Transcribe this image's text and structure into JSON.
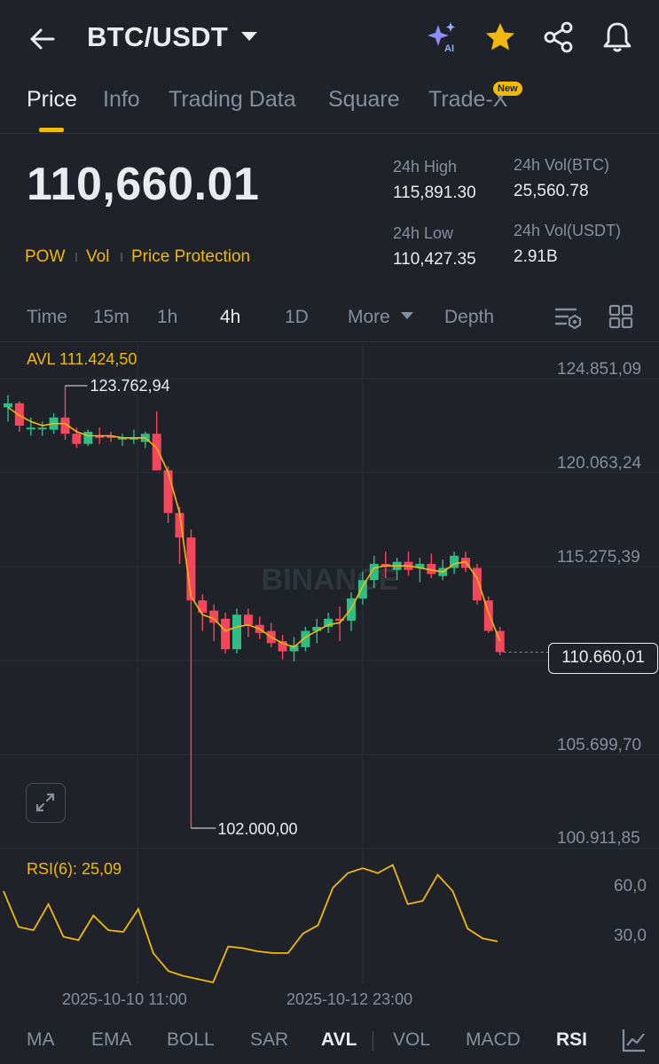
{
  "header": {
    "pair": "BTC/USDT",
    "icons": [
      "back-arrow-icon",
      "ai-sparkle-icon",
      "star-icon",
      "share-icon",
      "bell-icon"
    ],
    "ai_label": "AI"
  },
  "tabs": [
    {
      "label": "Price",
      "active": true
    },
    {
      "label": "Info"
    },
    {
      "label": "Trading Data"
    },
    {
      "label": "Square"
    },
    {
      "label": "Trade-X",
      "badge": "New"
    }
  ],
  "ticker": {
    "last_price": "110,660.01",
    "links": [
      "POW",
      "Vol",
      "Price Protection"
    ],
    "high_label": "24h High",
    "high": "115,891.30",
    "low_label": "24h Low",
    "low": "110,427.35",
    "vol_btc_label": "24h Vol(BTC)",
    "vol_btc": "25,560.78",
    "vol_usdt_label": "24h Vol(USDT)",
    "vol_usdt": "2.91B"
  },
  "intervals": {
    "items": [
      "Time",
      "15m",
      "1h",
      "4h",
      "1D",
      "More",
      "Depth"
    ],
    "active": "4h"
  },
  "chart": {
    "avl_label": "AVL 111.424,50",
    "watermark": "BINANCE",
    "price_tag": "110.660,01",
    "y_labels": [
      "124.851,09",
      "120.063,24",
      "115.275,39",
      "110.660,01",
      "105.699,70",
      "100.911,85"
    ],
    "high_marker": "123.762,94",
    "low_marker": "102.000,00",
    "rsi_label": "RSI(6): 25,09",
    "rsi_y_labels": [
      "60,0",
      "30,0"
    ],
    "x_labels": [
      "2025-10-10 11:00",
      "2025-10-12 23:00"
    ],
    "colors": {
      "up": "#2ebd85",
      "down": "#f6465d",
      "avl": "#f0b90b",
      "rsi": "#f0b90b"
    }
  },
  "chart_data": {
    "type": "candlestick",
    "interval": "4h",
    "y_range": [
      100000,
      125500
    ],
    "candles": [
      {
        "o": 122700,
        "h": 123300,
        "l": 122000,
        "c": 122900
      },
      {
        "o": 122900,
        "h": 123000,
        "l": 121500,
        "c": 121800
      },
      {
        "o": 121700,
        "h": 122200,
        "l": 121300,
        "c": 121700
      },
      {
        "o": 121700,
        "h": 122000,
        "l": 121300,
        "c": 121700
      },
      {
        "o": 121600,
        "h": 122400,
        "l": 121400,
        "c": 122200
      },
      {
        "o": 122200,
        "h": 123762.94,
        "l": 121100,
        "c": 121400
      },
      {
        "o": 121400,
        "h": 121700,
        "l": 120700,
        "c": 120900
      },
      {
        "o": 120900,
        "h": 121600,
        "l": 120800,
        "c": 121500
      },
      {
        "o": 121300,
        "h": 121700,
        "l": 120900,
        "c": 121200
      },
      {
        "o": 121300,
        "h": 121500,
        "l": 121000,
        "c": 121200
      },
      {
        "o": 121200,
        "h": 121400,
        "l": 120800,
        "c": 121200
      },
      {
        "o": 121200,
        "h": 121600,
        "l": 120900,
        "c": 121200
      },
      {
        "o": 121000,
        "h": 121500,
        "l": 120700,
        "c": 121400
      },
      {
        "o": 121400,
        "h": 122500,
        "l": 120300,
        "c": 119600
      },
      {
        "o": 119600,
        "h": 119800,
        "l": 117000,
        "c": 117500
      },
      {
        "o": 117500,
        "h": 117800,
        "l": 115000,
        "c": 116300
      },
      {
        "o": 116300,
        "h": 116700,
        "l": 102000.0,
        "c": 113200
      },
      {
        "o": 113200,
        "h": 113500,
        "l": 111700,
        "c": 112600
      },
      {
        "o": 112700,
        "h": 113000,
        "l": 111200,
        "c": 112100
      },
      {
        "o": 112300,
        "h": 112600,
        "l": 110600,
        "c": 110800
      },
      {
        "o": 110800,
        "h": 112800,
        "l": 110600,
        "c": 112500
      },
      {
        "o": 112500,
        "h": 112800,
        "l": 111400,
        "c": 112000
      },
      {
        "o": 112000,
        "h": 112400,
        "l": 111300,
        "c": 111600
      },
      {
        "o": 111700,
        "h": 112100,
        "l": 110900,
        "c": 111100
      },
      {
        "o": 111200,
        "h": 111500,
        "l": 110300,
        "c": 110700
      },
      {
        "o": 110700,
        "h": 111400,
        "l": 110200,
        "c": 111000
      },
      {
        "o": 110900,
        "h": 111900,
        "l": 110700,
        "c": 111700
      },
      {
        "o": 111700,
        "h": 112300,
        "l": 111100,
        "c": 111900
      },
      {
        "o": 111900,
        "h": 112600,
        "l": 111600,
        "c": 112300
      },
      {
        "o": 112300,
        "h": 112900,
        "l": 111200,
        "c": 112200
      },
      {
        "o": 112200,
        "h": 113600,
        "l": 111700,
        "c": 113300
      },
      {
        "o": 113300,
        "h": 114600,
        "l": 113000,
        "c": 114200
      },
      {
        "o": 114200,
        "h": 115400,
        "l": 113800,
        "c": 115000
      },
      {
        "o": 115000,
        "h": 115600,
        "l": 114300,
        "c": 114900
      },
      {
        "o": 114700,
        "h": 115300,
        "l": 114200,
        "c": 115100
      },
      {
        "o": 115100,
        "h": 115600,
        "l": 114400,
        "c": 114700
      },
      {
        "o": 114800,
        "h": 115300,
        "l": 114100,
        "c": 115000
      },
      {
        "o": 115000,
        "h": 115500,
        "l": 114300,
        "c": 114500
      },
      {
        "o": 114400,
        "h": 115200,
        "l": 114200,
        "c": 114800
      },
      {
        "o": 114800,
        "h": 115600,
        "l": 114500,
        "c": 115400
      },
      {
        "o": 115300,
        "h": 115600,
        "l": 114600,
        "c": 114800
      },
      {
        "o": 114800,
        "h": 115000,
        "l": 113000,
        "c": 113200
      },
      {
        "o": 113200,
        "h": 113400,
        "l": 111600,
        "c": 111700
      },
      {
        "o": 111700,
        "h": 111900,
        "l": 110500,
        "c": 110660
      }
    ],
    "avl_line": [
      122700,
      122300,
      122000,
      121800,
      121900,
      121900,
      121500,
      121300,
      121300,
      121300,
      121200,
      121200,
      121200,
      120700,
      119500,
      117500,
      113400,
      112500,
      112300,
      111700,
      111900,
      112000,
      111800,
      111400,
      111100,
      110900,
      111400,
      111700,
      112000,
      112100,
      112800,
      113900,
      114800,
      114900,
      114900,
      114900,
      114800,
      114700,
      114600,
      115000,
      115100,
      114300,
      112600,
      111200
    ],
    "rsi": [
      56,
      34,
      32,
      48,
      28,
      26,
      41,
      32,
      31,
      45,
      18,
      7,
      4,
      2,
      0,
      22,
      21,
      19,
      18,
      18,
      30,
      35,
      58,
      67,
      70,
      67,
      72,
      48,
      50,
      66,
      56,
      33,
      27,
      25.09
    ],
    "rsi_y_range": [
      0,
      75
    ]
  },
  "indicators": {
    "items": [
      "MA",
      "EMA",
      "BOLL",
      "SAR",
      "AVL",
      "VOL",
      "MACD",
      "RSI"
    ],
    "active": [
      "AVL",
      "RSI"
    ],
    "settings_icon": "chart-settings-icon"
  }
}
